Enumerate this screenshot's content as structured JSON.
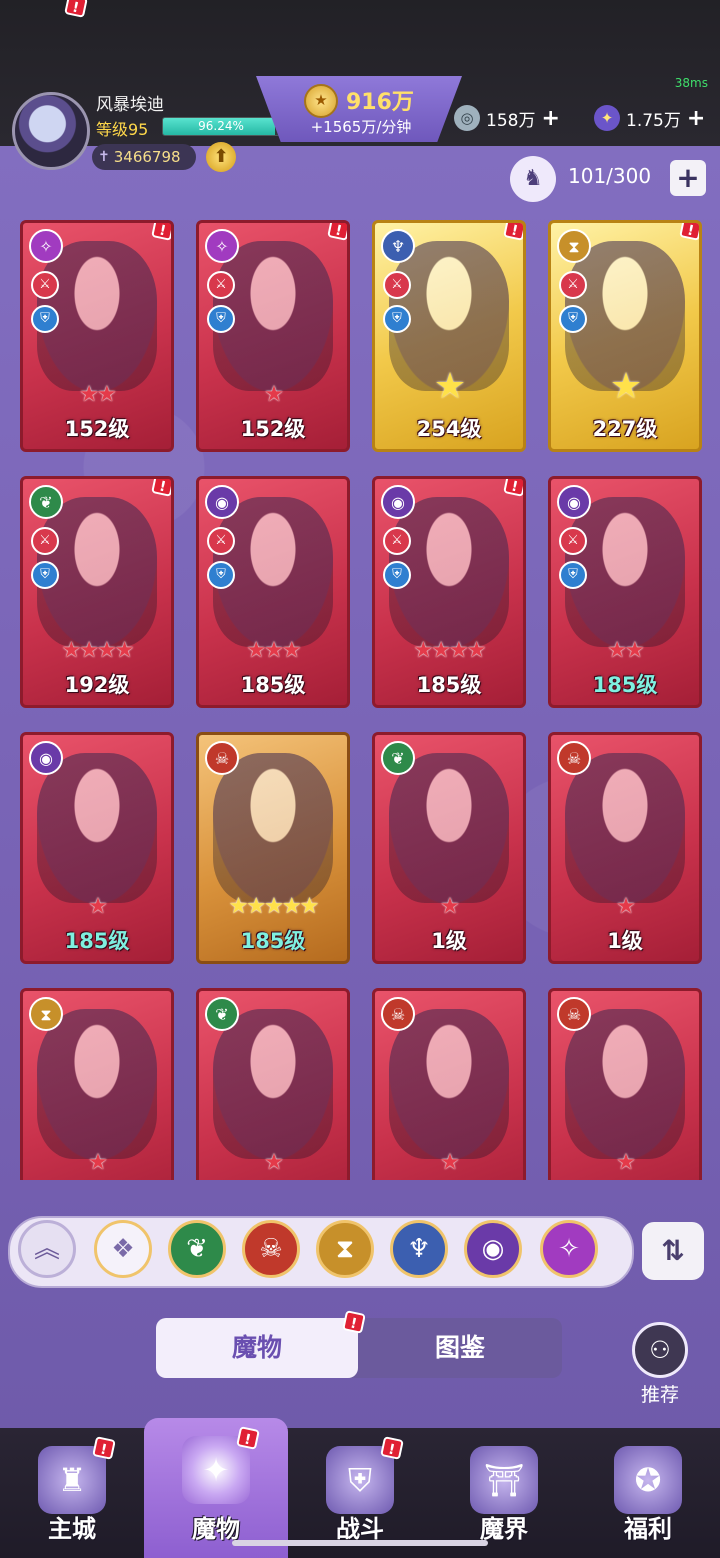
{
  "status": {
    "fps": "38ms"
  },
  "player": {
    "name": "风暴埃迪",
    "level_label": "等级95",
    "xp_percent": 96.24,
    "xp_text": "96.24%",
    "power": "3466798"
  },
  "currency": {
    "gold": "916万",
    "gold_rate": "+1565万/分钟",
    "silver": "158万",
    "gems": "1.75万"
  },
  "roster": {
    "count": "101/300"
  },
  "monsters": [
    {
      "element": "astral",
      "level": "152级",
      "stars": 2,
      "frame": "red",
      "notif": true
    },
    {
      "element": "astral",
      "level": "152级",
      "stars": 1,
      "frame": "red",
      "notif": true
    },
    {
      "element": "dragon",
      "level": "254级",
      "stars": 1,
      "frame": "gold",
      "notif": true,
      "star_style": "big"
    },
    {
      "element": "sand",
      "level": "227级",
      "stars": 1,
      "frame": "gold",
      "notif": true,
      "star_style": "big"
    },
    {
      "element": "leaf",
      "level": "192级",
      "stars": 4,
      "frame": "red",
      "notif": true
    },
    {
      "element": "eye",
      "level": "185级",
      "stars": 3,
      "frame": "red",
      "notif": false
    },
    {
      "element": "eye",
      "level": "185级",
      "stars": 4,
      "frame": "red",
      "notif": true
    },
    {
      "element": "eye",
      "level": "185级",
      "stars": 2,
      "frame": "red",
      "notif": false,
      "level_style": "teal"
    },
    {
      "element": "eye",
      "level": "185级",
      "stars": 1,
      "frame": "red",
      "notif": false,
      "level_style": "teal"
    },
    {
      "element": "demon",
      "level": "185级",
      "stars": 5,
      "frame": "orange",
      "notif": false,
      "level_style": "teal",
      "star_style": "gold5"
    },
    {
      "element": "leaf",
      "level": "1级",
      "stars": 1,
      "frame": "red",
      "notif": false
    },
    {
      "element": "demon",
      "level": "1级",
      "stars": 1,
      "frame": "red",
      "notif": false
    },
    {
      "element": "sand",
      "level": "",
      "stars": 1,
      "frame": "red",
      "notif": false
    },
    {
      "element": "leaf",
      "level": "",
      "stars": 1,
      "frame": "red",
      "notif": false
    },
    {
      "element": "demon",
      "level": "",
      "stars": 1,
      "frame": "red",
      "notif": false
    },
    {
      "element": "demon",
      "level": "",
      "stars": 1,
      "frame": "red",
      "notif": false
    }
  ],
  "filters": [
    "all",
    "leaf",
    "demon",
    "sand",
    "dragon",
    "eye",
    "astral"
  ],
  "tabs": {
    "active": "魔物",
    "inactive": "图鉴"
  },
  "recommend": {
    "label": "推荐"
  },
  "nav": [
    {
      "label": "主城",
      "icon": "castle-icon",
      "notif": true
    },
    {
      "label": "魔物",
      "icon": "flame-icon",
      "notif": true,
      "active": true
    },
    {
      "label": "战斗",
      "icon": "sword-shield-icon",
      "notif": true
    },
    {
      "label": "魔界",
      "icon": "portal-icon",
      "notif": false
    },
    {
      "label": "福利",
      "icon": "treasure-chest-icon",
      "notif": false
    }
  ]
}
